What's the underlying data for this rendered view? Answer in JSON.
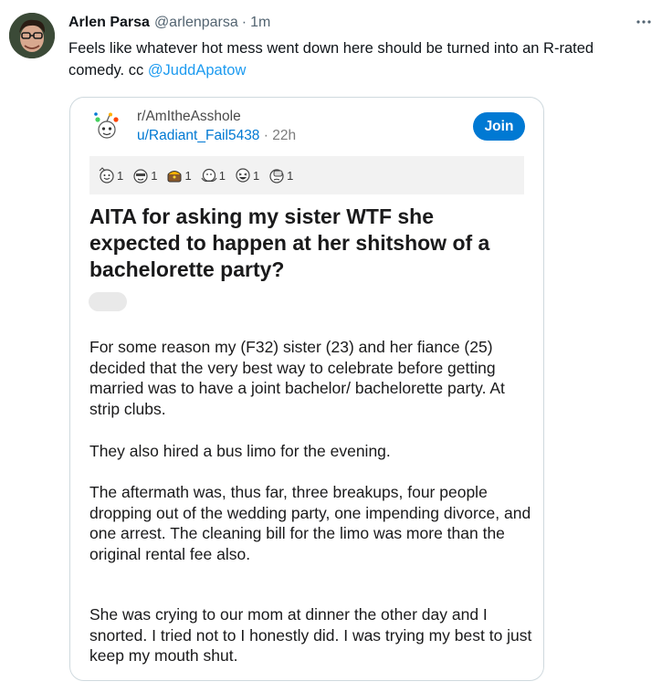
{
  "tweet": {
    "author_name": "Arlen Parsa",
    "handle": "@arlenparsa",
    "separator": "·",
    "time": "1m",
    "text": "Feels like whatever hot mess went down here should be turned into an R-rated comedy. cc ",
    "mention": "@JuddApatow"
  },
  "reddit_card": {
    "subreddit": "r/AmItheAsshole",
    "username": "u/Radiant_Fail5438",
    "separator": "·",
    "age": "22h",
    "join_label": "Join",
    "awards": [
      {
        "icon": "wholesome-award-icon",
        "count": "1"
      },
      {
        "icon": "helpful-award-icon",
        "count": "1"
      },
      {
        "icon": "treasure-award-icon",
        "count": "1"
      },
      {
        "icon": "hug-award-icon",
        "count": "1"
      },
      {
        "icon": "laughing-award-icon",
        "count": "1"
      },
      {
        "icon": "facepalm-award-icon",
        "count": "1"
      }
    ],
    "title": "AITA for asking my sister WTF she expected to happen at her shitshow of a bachelorette party?",
    "paragraphs": [
      "For some reason my (F32)  sister (23) and her fiance (25) decided that the very best way to celebrate before getting married was to have a joint bachelor/ bachelorette party. At strip clubs.",
      "They also hired a bus limo for the evening.",
      "The aftermath was, thus far, three breakups, four people dropping out of the wedding party, one impending divorce, and one arrest. The cleaning bill for the limo was more than the original rental fee also.",
      "She was crying to our mom at dinner the other day and I snorted. I tried not to I honestly did. I was trying my best to just keep my mouth shut."
    ]
  },
  "colors": {
    "link": "#1d9bf0",
    "reddit_blue": "#0079d3",
    "muted": "#536471"
  }
}
